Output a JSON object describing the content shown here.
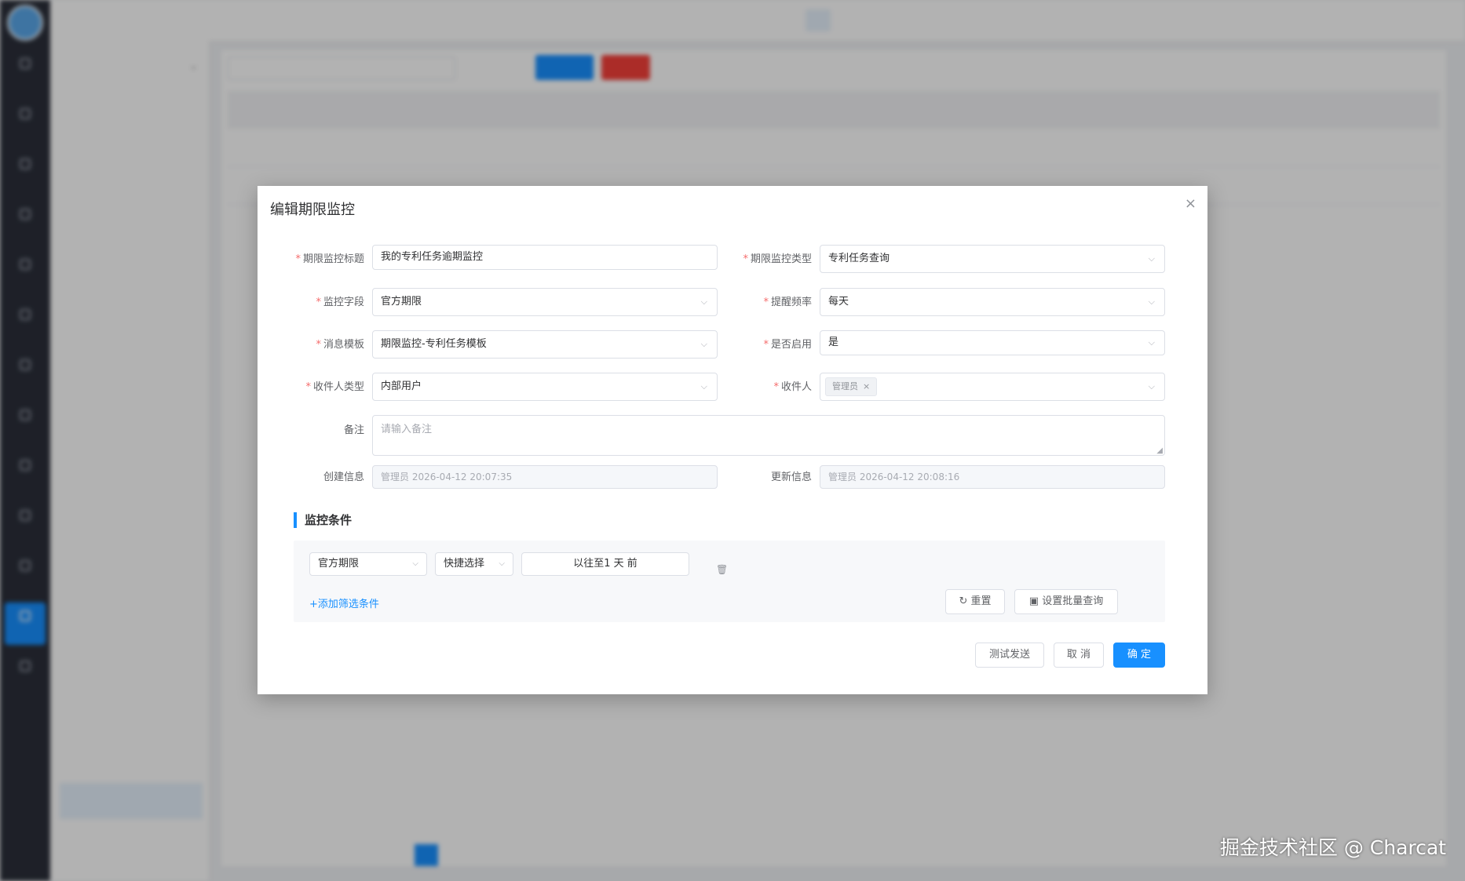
{
  "dialog": {
    "title": "编辑期限监控",
    "close_glyph": "×",
    "required_mark": "*",
    "fields": {
      "title_label": "期限监控标题",
      "title_value": "我的专利任务逾期监控",
      "type_label": "期限监控类型",
      "type_value": "专利任务查询",
      "field_label": "监控字段",
      "field_value": "官方期限",
      "freq_label": "提醒频率",
      "freq_value": "每天",
      "template_label": "消息模板",
      "template_value": "期限监控-专利任务模板",
      "enabled_label": "是否启用",
      "enabled_value": "是",
      "recipient_type_label": "收件人类型",
      "recipient_type_value": "内部用户",
      "recipient_label": "收件人",
      "recipient_tag": "管理员",
      "remark_label": "备注",
      "remark_placeholder": "请输入备注",
      "created_label": "创建信息",
      "created_value": "管理员   2026-04-12 20:07:35",
      "updated_label": "更新信息",
      "updated_value": "管理员   2026-04-12 20:08:16"
    },
    "section_title": "监控条件",
    "condition": {
      "field": "官方期限",
      "quick": "快捷选择",
      "range": "以往至1 天 前",
      "add_label": "+添加筛选条件",
      "reset_label": "重置",
      "batch_label": "设置批量查询"
    },
    "footer": {
      "test_label": "测试发送",
      "cancel_label": "取 消",
      "confirm_label": "确 定"
    }
  },
  "watermark": "掘金技术社区 @ Charcat",
  "colors": {
    "primary": "#1890ff",
    "danger": "#f5403a",
    "rail": "#2b2f3a"
  },
  "icons": {
    "chevron": "chevron-down-icon",
    "trash": "trash-icon",
    "reset": "reset-icon",
    "save": "save-icon",
    "close": "close-icon",
    "tag_close": "tag-close-icon"
  }
}
